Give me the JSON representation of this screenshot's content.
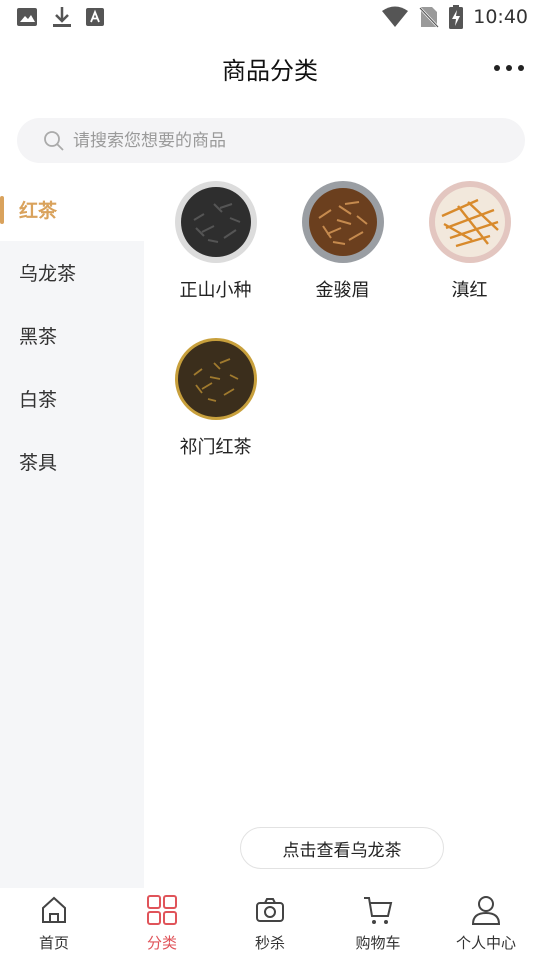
{
  "status_bar": {
    "time": "10:40",
    "icons": [
      "image-icon",
      "download-icon",
      "font-icon",
      "wifi-icon",
      "no-sim-icon",
      "battery-charging-icon"
    ]
  },
  "header": {
    "title": "商品分类",
    "more_icon": "more-dots-icon"
  },
  "search": {
    "placeholder": "请搜索您想要的商品",
    "icon": "search-icon"
  },
  "sidebar": {
    "items": [
      {
        "label": "红茶",
        "active": true
      },
      {
        "label": "乌龙茶",
        "active": false
      },
      {
        "label": "黑茶",
        "active": false
      },
      {
        "label": "白茶",
        "active": false
      },
      {
        "label": "茶具",
        "active": false
      }
    ]
  },
  "products": [
    {
      "name": "正山小种"
    },
    {
      "name": "金骏眉"
    },
    {
      "name": "滇红"
    },
    {
      "name": "祁门红茶"
    }
  ],
  "view_more": {
    "label": "点击查看乌龙茶"
  },
  "tabbar": {
    "tabs": [
      {
        "label": "首页",
        "icon": "home-icon",
        "active": false
      },
      {
        "label": "分类",
        "icon": "grid-icon",
        "active": true
      },
      {
        "label": "秒杀",
        "icon": "flash-sale-icon",
        "active": false
      },
      {
        "label": "购物车",
        "icon": "cart-icon",
        "active": false
      },
      {
        "label": "个人中心",
        "icon": "user-icon",
        "active": false
      }
    ]
  },
  "colors": {
    "accent": "#d9a25c",
    "tab_active": "#e0545a",
    "sidebar_bg": "#f5f6f8"
  }
}
